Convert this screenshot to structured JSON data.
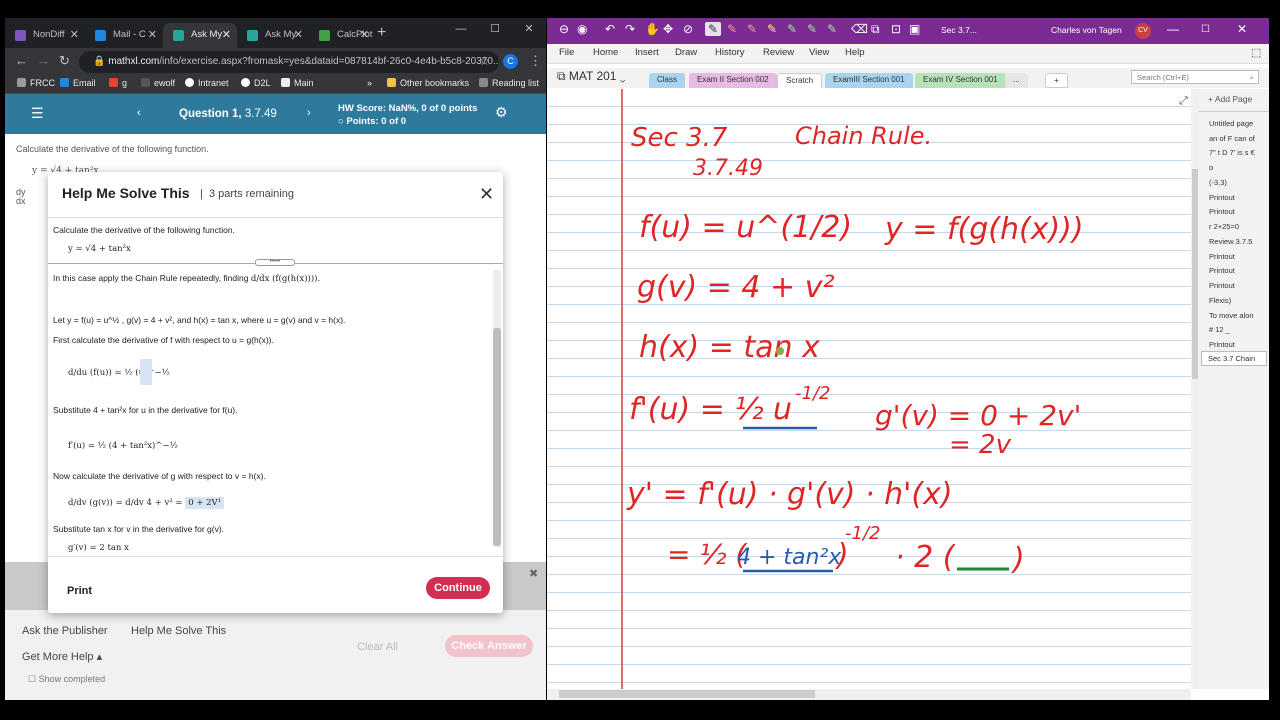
{
  "browser": {
    "tabs": [
      {
        "label": "NonDiff",
        "icon": "triangle-icon",
        "color": "#7e57c2"
      },
      {
        "label": "Mail - C",
        "icon": "mail-icon",
        "color": "#1e88e5"
      },
      {
        "label": "Ask My",
        "icon": "p-icon",
        "color": "#26a69a"
      },
      {
        "label": "Ask My",
        "icon": "p-icon",
        "color": "#26a69a"
      },
      {
        "label": "CalcPlot",
        "icon": "calcplot-icon",
        "color": "#43a047"
      }
    ],
    "new_tab": "+",
    "url_domain": "mathxl.com",
    "url_path": "/info/exercise.aspx?fromask=yes&dataid=087814bf-26c0-4e4b-b5c8-20370...",
    "profile_initial": "C",
    "bookmarks": [
      "FRCC",
      "Email",
      "g",
      "ewolf",
      "Intranet",
      "D2L",
      "Main"
    ],
    "bookmarks_more": "»",
    "other_bookmarks": "Other bookmarks",
    "reading_list": "Reading list"
  },
  "mathxl": {
    "question_label": "Question 1,",
    "question_num": "3.7.49",
    "hw_score": "HW Score: NaN%, 0 of 0 points",
    "points": "Points: 0 of 0",
    "bg_question": "Calculate the derivative of the following function.",
    "bg_func": "y = √4 + tan²x",
    "bg_dy": "dy",
    "bg_dx": "dx",
    "modal": {
      "title": "Help Me Solve This",
      "parts": "3 parts remaining",
      "question": "Calculate the derivative of the following function.",
      "func": "y = √4 + tan²x",
      "step1_text": "In this case apply the Chain Rule repeatedly, finding",
      "step1_math": "d/dx (f(g(h(x)))).",
      "step2_text": "Let y = f(u) = u^½ , g(v) = 4 + v², and h(x) = tan x, where u = g(v) and v = h(x).",
      "step3_text": "First calculate the derivative of f with respect to u = g(h(x)).",
      "step3_math": "d/du (f(u)) = ½ (u)^−½",
      "step4_text": "Substitute 4 + tan²x for u in the derivative for f(u).",
      "step4_math": "f′(u) = ½ (4 + tan²x)^−½",
      "step5_text": "Now calculate the derivative of g with respect to v = h(x).",
      "step5_math": "d/dv (g(v)) = d/dv 4 + v² =",
      "step5_answer": "0 + 2V¹",
      "step6_text": "Substitute tan x for v in the derivative for g(v).",
      "step6_math": "g′(v) = 2 tan x",
      "print": "Print",
      "continue": "Continue"
    },
    "ask_publisher": "Ask the Publisher",
    "help_me_solve": "Help Me Solve This",
    "get_more_help": "Get More Help ▴",
    "show_completed": "Show completed",
    "clear_all": "Clear All",
    "check_answer": "Check Answer"
  },
  "onenote": {
    "page_name": "Sec 3.7...",
    "user": "Charles von Tagen",
    "user_initials": "CV",
    "menu": [
      "File",
      "Home",
      "Insert",
      "Draw",
      "History",
      "Review",
      "View",
      "Help"
    ],
    "notebook": "MAT 201",
    "sections": [
      {
        "label": "Class",
        "color": "#a9d3ef"
      },
      {
        "label": "Exam II Section 002",
        "color": "#e9b9e6"
      },
      {
        "label": "Scratch",
        "color": "#ffffff"
      },
      {
        "label": "ExamIII Section 001",
        "color": "#a9d3ef"
      },
      {
        "label": "Exam IV Section 001",
        "color": "#b7e2b7"
      },
      {
        "label": "...",
        "color": "#e6e6e6"
      }
    ],
    "search_placeholder": "Search (Ctrl+E)",
    "add_page": "Add Page",
    "pages": [
      "Untitled page",
      "an of F can of",
      "7\" t D 7' is s €",
      "o",
      "(-3,3)",
      "Printout",
      "Printout",
      "r 2+25=0",
      "Review 3.7.5",
      "Printout",
      "Printout",
      "Printout",
      "Flexis)",
      "To move alon",
      "# 12 _",
      "Printout",
      "Sec 3.7 Chain"
    ],
    "ink": {
      "title1": "Sec 3.7",
      "title2": "Chain Rule.",
      "num": "3.7.49",
      "l1": "f(u) = u^(1/2)",
      "l1b": "y = f(g(h(x)))",
      "l2": "g(v) = 4 + v²",
      "l3": "h(x) = tan x",
      "l4a": "f'(u) = ½",
      "l4u": "u",
      "l4exp": "-1/2",
      "l4b": "g'(v) = 0 + 2v'",
      "l4c": "= 2v",
      "l5": "y' = f'(u) · g'(v) · h'(x)",
      "l6a": "= ½ (",
      "l6inner": "4 + tan²x",
      "l6b": ")",
      "l6exp": "-1/2",
      "l6c": "· 2 (",
      "l6d": ")"
    }
  }
}
